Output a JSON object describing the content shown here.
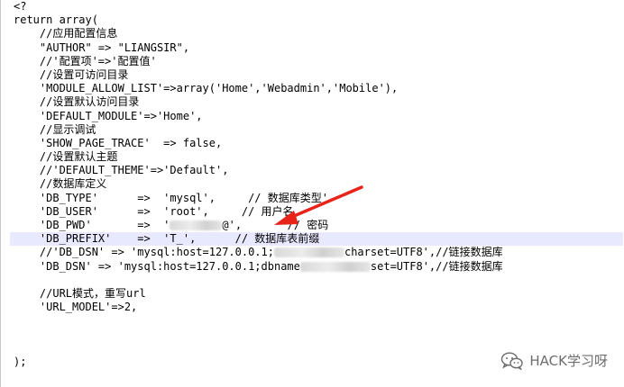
{
  "code_lines": [
    "<?",
    "return array(",
    "    //应用配置信息",
    "    \"AUTHOR\" => \"LIANGSIR\",",
    "    //'配置项'=>'配置值'",
    "    //设置可访问目录",
    "    'MODULE_ALLOW_LIST'=>array('Home','Webadmin','Mobile'),",
    "    //设置默认访问目录",
    "    'DEFAULT_MODULE'=>'Home',",
    "    //显示调试",
    "    'SHOW_PAGE_TRACE'  => false,",
    "    //设置默认主题",
    "    //'DEFAULT_THEME'=>'Default',",
    "    //数据库定义",
    "    'DB_TYPE'      =>  'mysql',     // 数据库类型'",
    "    'DB_USER'      =>  'root',     // 用户名",
    "    'DB_PWD'       =>  '",
    "    'DB_PREFIX'    =>  'T_',      // 数据库表前缀",
    "    //'DB_DSN' => 'mysql:host=127.0.0.1;",
    "    'DB_DSN' => 'mysql:host=127.0.0.1;dbname",
    "",
    "    //URL模式，重写url",
    "    'URL_MODEL'=>2,",
    "",
    "",
    "",
    ");"
  ],
  "line_fragments": {
    "db_pwd_tail": "@',       // 密码",
    "db_dsn_comment_tail": "charset=UTF8',//链接数据库",
    "db_dsn_tail": "set=UTF8',//链接数据库"
  },
  "watermark": {
    "text": "HACK学习呀",
    "icon": "wechat-icon"
  },
  "colors": {
    "highlight": "#e8e8ff",
    "arrow": "#e8231a",
    "watermark": "#6d6d6d"
  }
}
